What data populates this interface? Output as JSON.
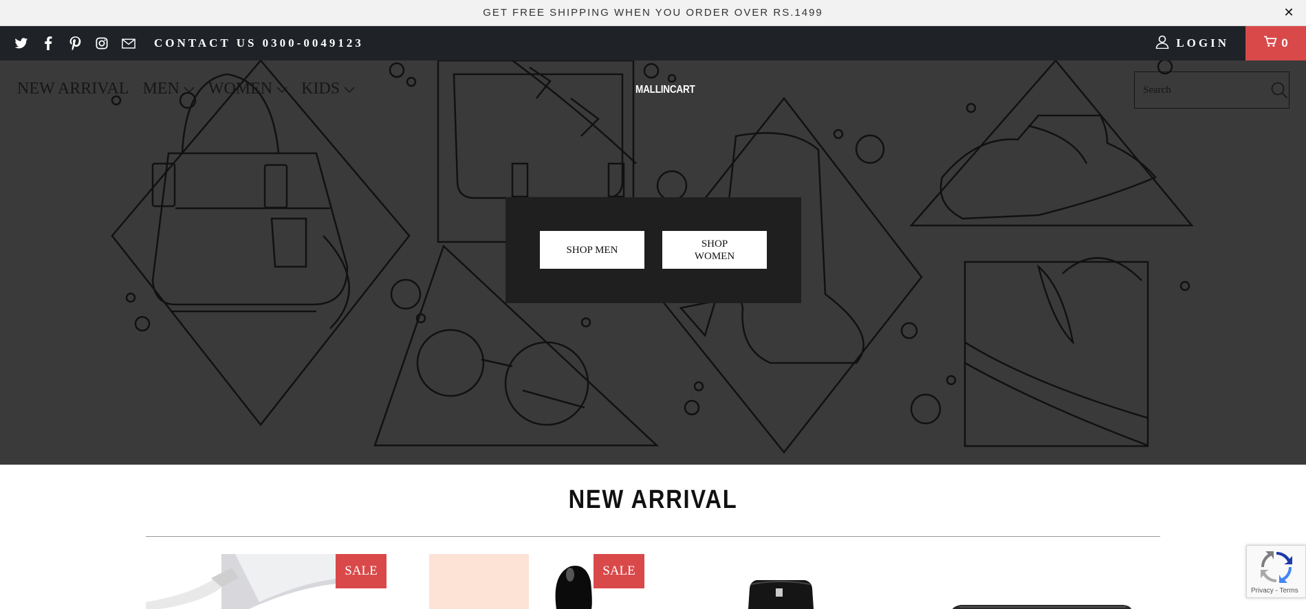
{
  "announcement": {
    "text": "GET FREE SHIPPING WHEN YOU ORDER OVER RS.1499",
    "close_glyph": "✕"
  },
  "topbar": {
    "social_icons": [
      "twitter-icon",
      "facebook-icon",
      "pinterest-icon",
      "instagram-icon",
      "mail-icon"
    ],
    "contact": "CONTACT US 0300-0049123",
    "login_label": "LOGIN",
    "cart_count": "0"
  },
  "header": {
    "nav": [
      {
        "label": "NEW ARRIVAL",
        "has_dropdown": false
      },
      {
        "label": "MEN",
        "has_dropdown": true
      },
      {
        "label": "WOMEN",
        "has_dropdown": true
      },
      {
        "label": "KIDS",
        "has_dropdown": true
      }
    ],
    "brand": "MALLINCART",
    "search_placeholder": "Search"
  },
  "hero": {
    "shop_men": "SHOP MEN",
    "shop_women": "SHOP WOMEN"
  },
  "new_arrival": {
    "title": "NEW ARRIVAL",
    "products": [
      {
        "badge": "SALE"
      },
      {
        "badge": "SALE"
      },
      {
        "badge": ""
      },
      {
        "badge": ""
      }
    ]
  },
  "recaptcha": {
    "links": "Privacy - Terms"
  },
  "colors": {
    "accent": "#d9494a",
    "topbar": "#1f2227",
    "hero_bg": "#3a3a3a"
  }
}
